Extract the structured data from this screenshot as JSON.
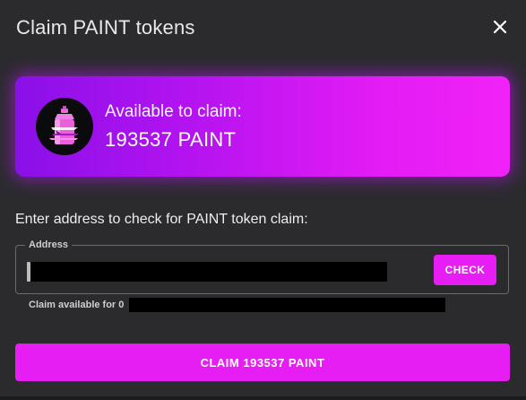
{
  "dialog": {
    "title": "Claim PAINT tokens",
    "close_icon": "close-icon"
  },
  "claim_card": {
    "label": "Available to claim:",
    "amount": "193537 PAINT",
    "icon": "spray-paint-can-icon",
    "gradient_start": "#8a10e8",
    "gradient_end": "#f022f7"
  },
  "form": {
    "prompt": "Enter address to check for PAINT token claim:",
    "address_label": "Address",
    "address_value": "",
    "check_label": "CHECK",
    "status_text": "Claim available for 0"
  },
  "actions": {
    "claim_label": "CLAIM 193537 PAINT"
  },
  "colors": {
    "accent": "#e71ef3",
    "background": "#2b2b2e"
  }
}
